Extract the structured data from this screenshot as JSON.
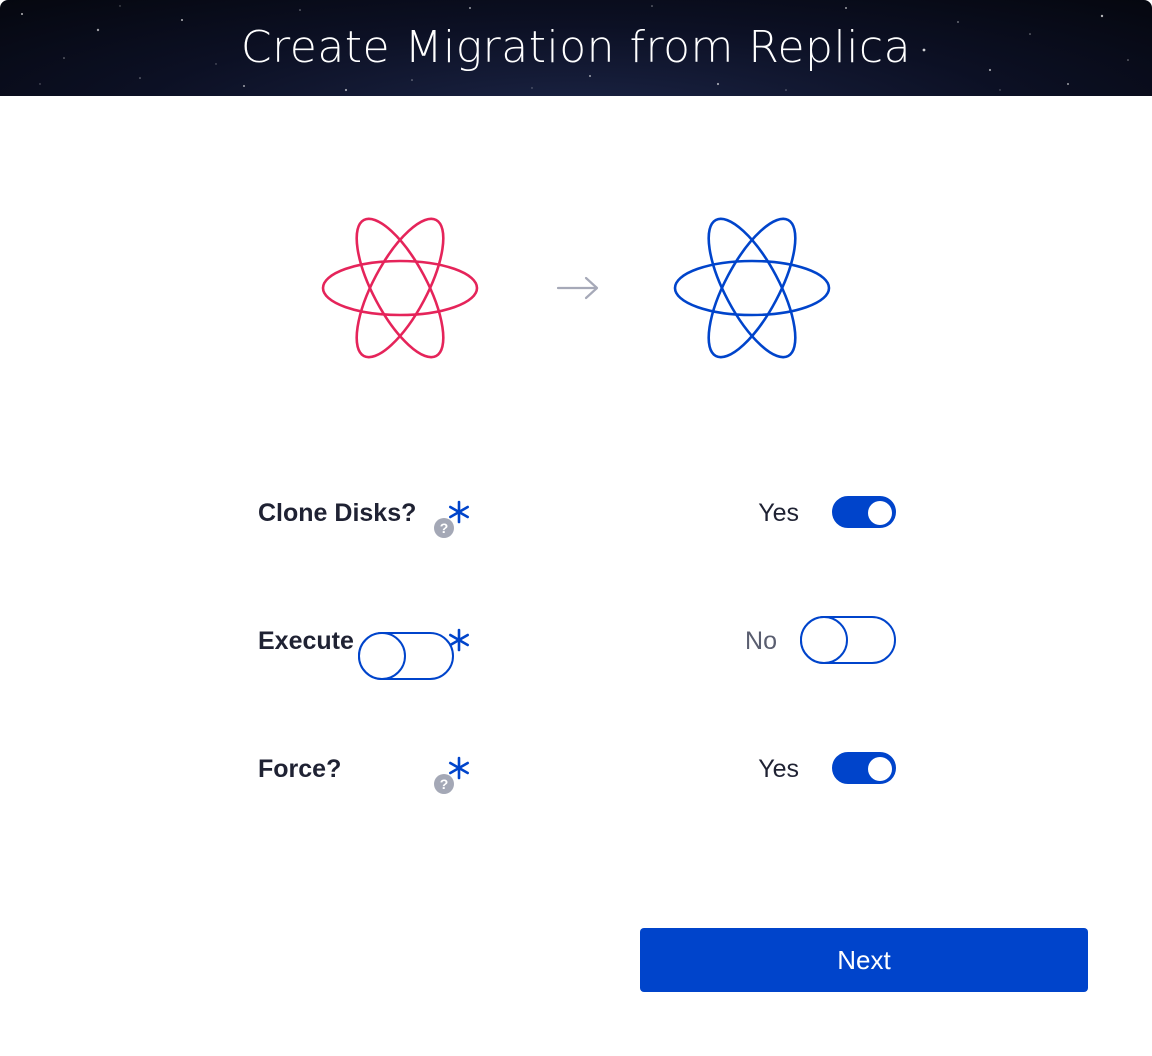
{
  "header": {
    "title": "Create Migration from Replica"
  },
  "logos": {
    "source_color": "#e5245a",
    "target_color": "#0044cb",
    "arrow_color": "#a6a9b8"
  },
  "fields": [
    {
      "label": "Clone Disks?",
      "required": true,
      "has_help": true,
      "value_label": "Yes",
      "enabled": true
    },
    {
      "label": "Execute",
      "required": true,
      "has_help": false,
      "value_label": "No",
      "enabled": false
    },
    {
      "label": "Force?",
      "required": true,
      "has_help": true,
      "value_label": "Yes",
      "enabled": true
    }
  ],
  "help_icon_glyph": "?",
  "next_button": {
    "label": "Next"
  },
  "colors": {
    "accent": "#0044cb",
    "help_gray": "#a4a8b6",
    "text_dark": "#1f2233"
  }
}
